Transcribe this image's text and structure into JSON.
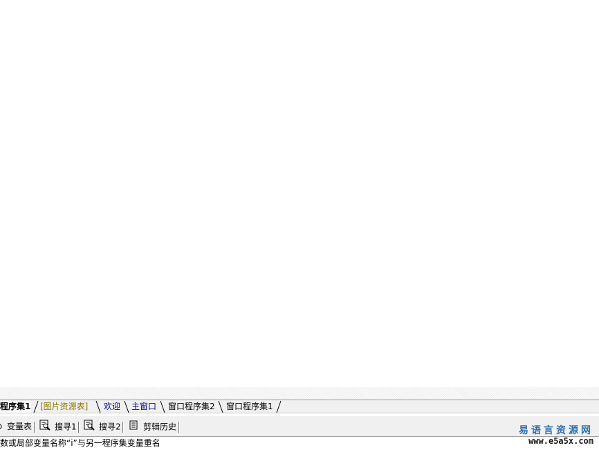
{
  "tabs": [
    {
      "label": "程序集1",
      "state": "active"
    },
    {
      "label": "[图片资源表]",
      "state": "resource"
    },
    {
      "label": "欢迎",
      "state": "link"
    },
    {
      "label": "主窗口",
      "state": "link"
    },
    {
      "label": "窗口程序集2",
      "state": "normal"
    },
    {
      "label": "窗口程序集1",
      "state": "normal"
    }
  ],
  "toolbar": {
    "items": [
      {
        "label": "变量表",
        "icon": "variable-table-icon"
      },
      {
        "label": "搜寻1",
        "icon": "magnifier-doc-icon"
      },
      {
        "label": "搜寻2",
        "icon": "magnifier-doc-icon"
      },
      {
        "label": "剪辑历史",
        "icon": "clipboard-doc-icon"
      }
    ]
  },
  "status": {
    "message": "数或局部变量名称“i”与另一程序集变量重名"
  },
  "watermark": {
    "title": "易语言资源网",
    "url": "www.e5a5x.com"
  },
  "colors": {
    "resource_tab": "#8a7a00",
    "link_tab": "#00008b",
    "watermark_title": "#2f6fb0"
  }
}
